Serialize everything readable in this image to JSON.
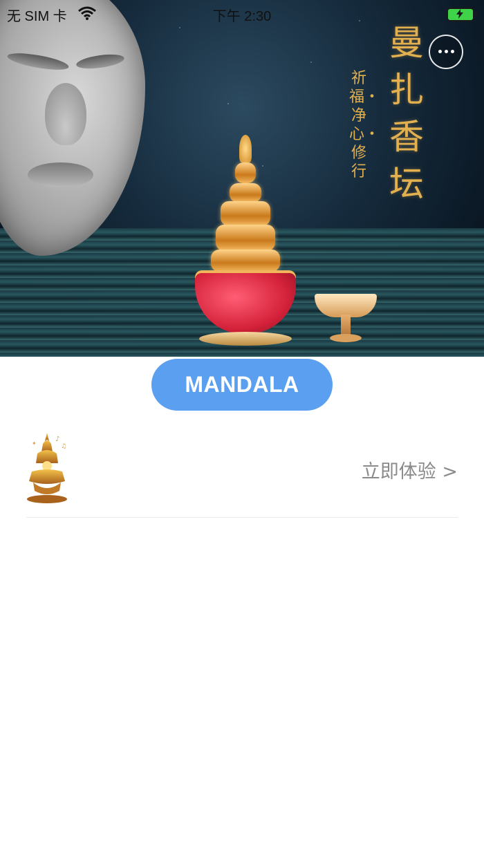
{
  "status_bar": {
    "carrier": "无 SIM 卡",
    "time": "下午 2:30",
    "wifi_icon": "wifi-icon",
    "battery_icon": "battery-charging-icon"
  },
  "banner": {
    "title": "曼扎香坛",
    "subtitle": "祈福・净心・修行",
    "gold_color": "#e3b04f"
  },
  "actions": {
    "more_icon": "more-icon",
    "mandala_button_label": "MANDALA",
    "mandala_button_color": "#5b9ff0"
  },
  "list": {
    "items": [
      {
        "icon": "mandala-offering-icon",
        "cta": "立即体验 >"
      }
    ]
  }
}
